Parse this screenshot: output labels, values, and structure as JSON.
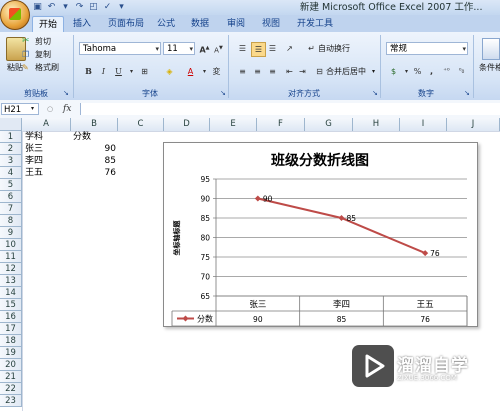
{
  "window": {
    "title": "新建 Microsoft Office Excel 2007 工作..."
  },
  "tabs": [
    "开始",
    "插入",
    "页面布局",
    "公式",
    "数据",
    "审阅",
    "视图",
    "开发工具"
  ],
  "ribbon": {
    "clipboard": {
      "paste": "粘贴",
      "cut": "剪切",
      "copy": "复制",
      "format_painter": "格式刷",
      "label": "剪贴板"
    },
    "font": {
      "name": "Tahoma",
      "size": "11",
      "bold": "B",
      "italic": "I",
      "underline": "U",
      "grow": "A",
      "shrink": "A",
      "color_glyph": "A",
      "label": "字体"
    },
    "alignment": {
      "wrap": "自动换行",
      "merge": "合并后居中",
      "label": "对齐方式"
    },
    "number": {
      "format": "常规",
      "percent": "%",
      "comma": ",",
      "label": "数字"
    },
    "styles": {
      "cond_format": "条件格式"
    }
  },
  "formula_bar": {
    "name_box": "H21",
    "fx": "fx",
    "value": ""
  },
  "columns": [
    "A",
    "B",
    "C",
    "D",
    "E",
    "F",
    "G",
    "H",
    "I",
    "J"
  ],
  "rows": [
    "1",
    "2",
    "3",
    "4",
    "5",
    "6",
    "7",
    "8",
    "9",
    "10",
    "11",
    "12",
    "13",
    "14",
    "15",
    "16",
    "17",
    "18",
    "19",
    "20",
    "21",
    "22",
    "23"
  ],
  "sheet": {
    "headers": [
      "学科",
      "分数"
    ],
    "data": [
      {
        "name": "张三",
        "score": "90"
      },
      {
        "name": "李四",
        "score": "85"
      },
      {
        "name": "王五",
        "score": "76"
      }
    ]
  },
  "chart_data": {
    "type": "line",
    "title": "班级分数折线图",
    "ylabel": "坐标轴标题",
    "xlabel": "",
    "categories": [
      "张三",
      "李四",
      "王五"
    ],
    "series": [
      {
        "name": "分数",
        "values": [
          90,
          85,
          76
        ],
        "color": "#be4b48"
      }
    ],
    "ylim": [
      65,
      95
    ],
    "yticks": [
      "95",
      "90",
      "85",
      "80",
      "75",
      "70",
      "65"
    ],
    "data_labels": [
      "90",
      "85",
      "76"
    ],
    "table_values": [
      "90",
      "85",
      "76"
    ],
    "grid": true,
    "legend": "data-table"
  },
  "watermark": {
    "text": "溜溜自学",
    "sub": "ZIXUE.3066.COM"
  }
}
